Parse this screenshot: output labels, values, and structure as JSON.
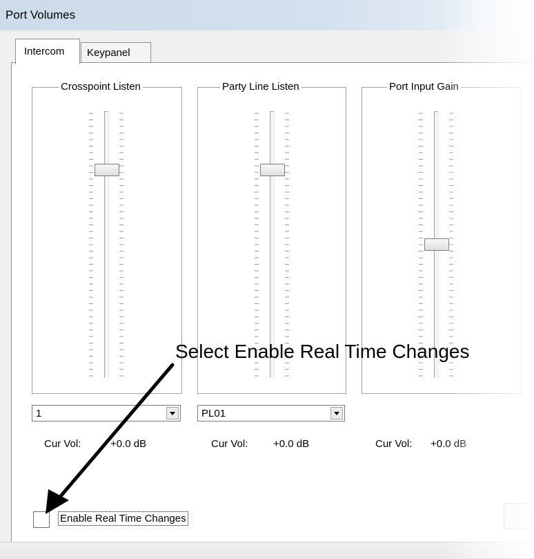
{
  "window": {
    "title": "Port Volumes"
  },
  "tabs": [
    {
      "label": "Intercom",
      "selected": true
    },
    {
      "label": "Keypanel",
      "selected": false
    }
  ],
  "groups": [
    {
      "label": "Crosspoint Listen",
      "select_value": "1",
      "cur_vol_label": "Cur Vol:",
      "cur_vol_value": "+0.0 dB",
      "slider_level": 0.78
    },
    {
      "label": "Party Line Listen",
      "select_value": "PL01",
      "cur_vol_label": "Cur Vol:",
      "cur_vol_value": "+0.0 dB",
      "slider_level": 0.78
    },
    {
      "label": "Port Input Gain",
      "select_value": "",
      "cur_vol_label": "Cur Vol:",
      "cur_vol_value": "+0.0 dB",
      "slider_level": 0.5
    }
  ],
  "checkbox": {
    "label": "Enable Real Time Changes",
    "checked": false
  },
  "annotation": {
    "text": "Select Enable Real Time Changes"
  },
  "icons": {
    "dropdown": "chevron-down-icon",
    "arrow": "annotation-arrow-icon"
  }
}
